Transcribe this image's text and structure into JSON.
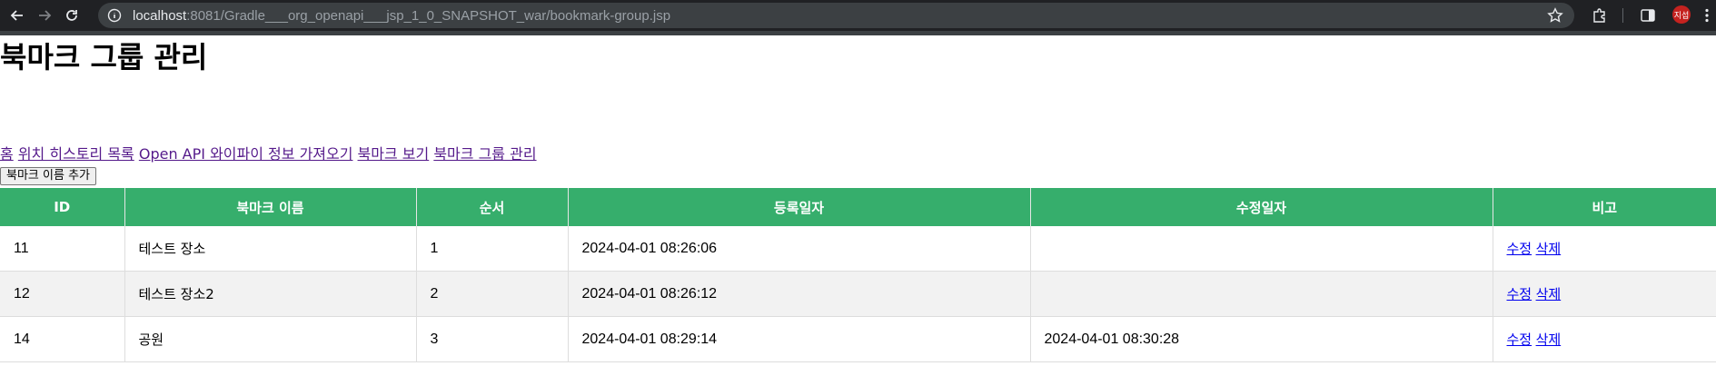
{
  "browser": {
    "url_host": "localhost",
    "url_rest": ":8081/Gradle___org_openapi___jsp_1_0_SNAPSHOT_war/bookmark-group.jsp",
    "profile_label": "지섭"
  },
  "page": {
    "title": "북마크 그룹 관리",
    "nav": [
      {
        "label": "홈"
      },
      {
        "label": "위치 히스토리 목록"
      },
      {
        "label": "Open API 와이파이 정보 가져오기"
      },
      {
        "label": "북마크 보기"
      },
      {
        "label": "북마크 그룹 관리"
      }
    ],
    "add_button": "북마크 이름 추가"
  },
  "table": {
    "columns": [
      "ID",
      "북마크 이름",
      "순서",
      "등록일자",
      "수정일자",
      "비고"
    ],
    "rows": [
      {
        "id": "11",
        "name": "테스트 장소",
        "order": "1",
        "created": "2024-04-01 08:26:06",
        "modified": "",
        "edit": "수정",
        "delete": "삭제"
      },
      {
        "id": "12",
        "name": "테스트 장소2",
        "order": "2",
        "created": "2024-04-01 08:26:12",
        "modified": "",
        "edit": "수정",
        "delete": "삭제"
      },
      {
        "id": "14",
        "name": "공원",
        "order": "3",
        "created": "2024-04-01 08:29:14",
        "modified": "2024-04-01 08:30:28",
        "edit": "수정",
        "delete": "삭제"
      }
    ]
  },
  "colors": {
    "header_bg": "#36ae6c",
    "visited_link": "#551a8b",
    "link": "#0000ee"
  }
}
